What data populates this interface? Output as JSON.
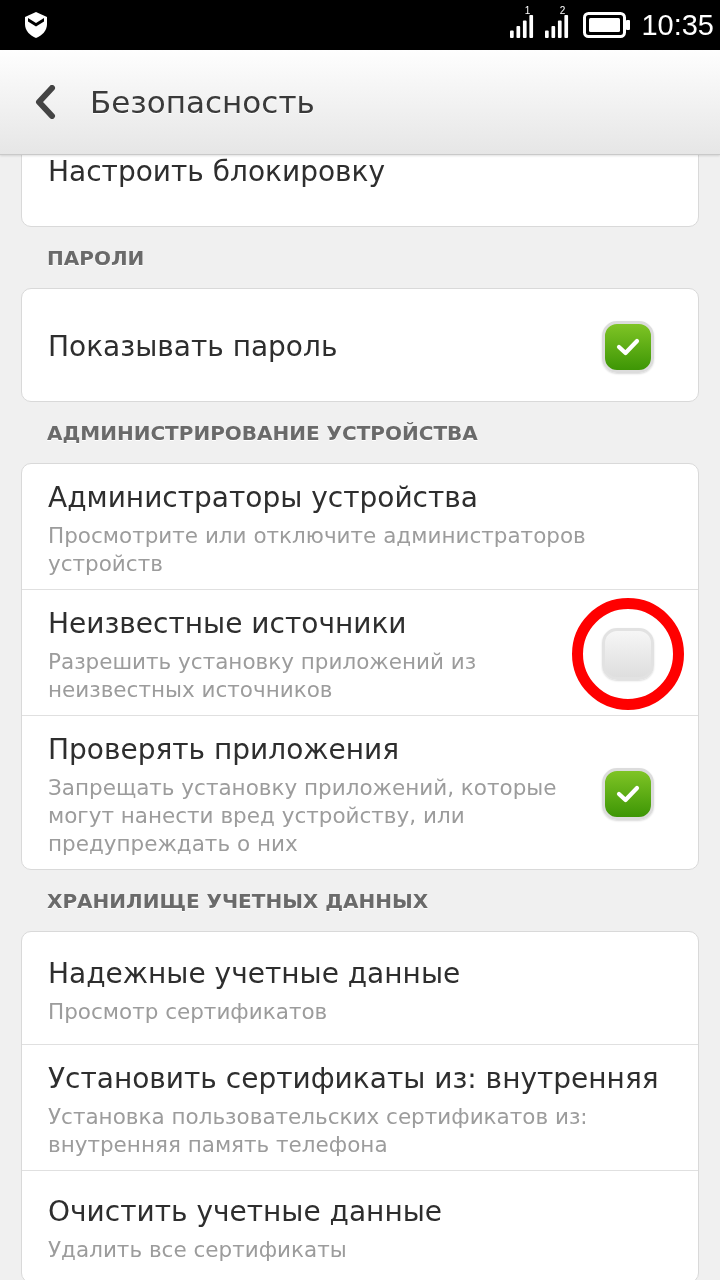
{
  "status_bar": {
    "sims": [
      {
        "label": "1"
      },
      {
        "label": "2"
      }
    ],
    "time": "10:35"
  },
  "header": {
    "title": "Безопасность"
  },
  "sections": [
    {
      "items": [
        {
          "kind": "plain",
          "title": "Настроить блокировку"
        }
      ]
    },
    {
      "heading": "ПАРОЛИ",
      "items": [
        {
          "kind": "checkbox",
          "title": "Показывать пароль",
          "checked": true,
          "highlighted": false
        }
      ]
    },
    {
      "heading": "АДМИНИСТРИРОВАНИЕ УСТРОЙСТВА",
      "items": [
        {
          "kind": "plain",
          "title": "Администраторы устройства",
          "summary": "Просмотрите или отключите администраторов устройств"
        },
        {
          "kind": "checkbox",
          "title": "Неизвестные источники",
          "summary": "Разрешить установку приложений из неизвестных источников",
          "checked": false,
          "highlighted": true
        },
        {
          "kind": "checkbox",
          "title": "Проверять приложения",
          "summary": "Запрещать установку приложений, которые могут нанести вред устройству, или предупреждать о них",
          "checked": true,
          "highlighted": false
        }
      ]
    },
    {
      "heading": "ХРАНИЛИЩЕ УЧЕТНЫХ ДАННЫХ",
      "items": [
        {
          "kind": "plain",
          "title": "Надежные учетные данные",
          "summary": "Просмотр сертификатов"
        },
        {
          "kind": "plain",
          "title": "Установить сертификаты из: внутренняя",
          "summary": "Установка пользовательских сертификатов из: внутренняя память телефона"
        },
        {
          "kind": "plain",
          "title": "Очистить учетные данные",
          "summary": "Удалить все сертификаты"
        }
      ]
    }
  ]
}
